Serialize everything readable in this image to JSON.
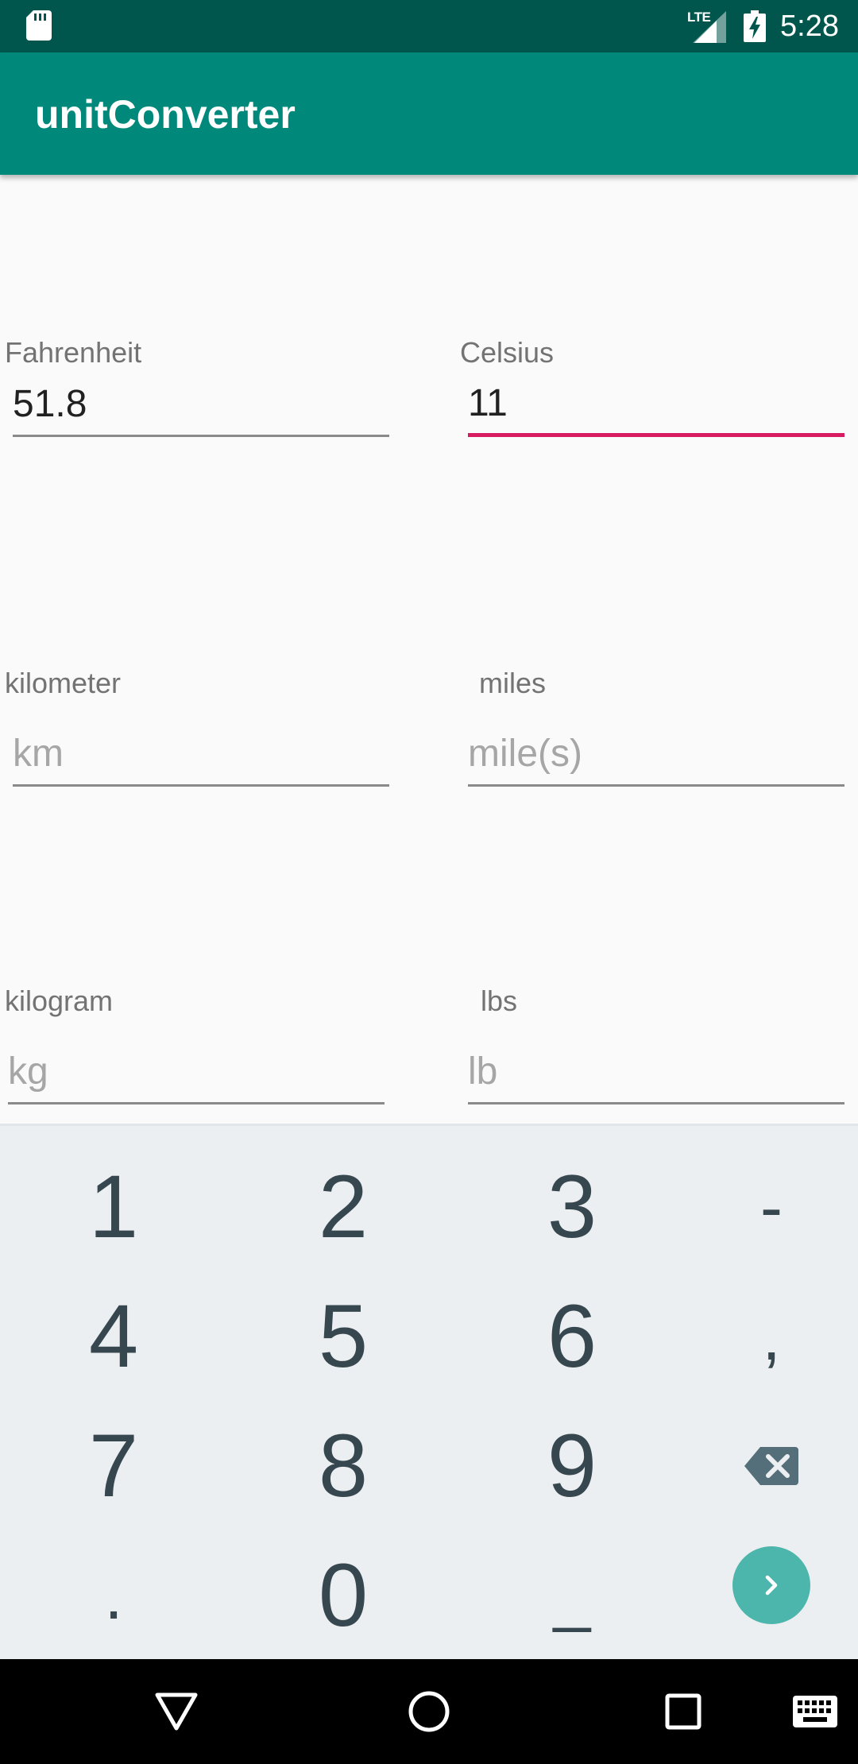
{
  "status_bar": {
    "time": "5:28",
    "network_label": "LTE",
    "icons": [
      "sd-card-icon",
      "signal-icon",
      "battery-charging-icon"
    ]
  },
  "app": {
    "title": "unitConverter"
  },
  "fields": {
    "fahrenheit": {
      "label": "Fahrenheit",
      "value": "51.8",
      "placeholder": ""
    },
    "celsius": {
      "label": "Celsius",
      "value": "11",
      "placeholder": ""
    },
    "kilometer": {
      "label": "kilometer",
      "value": "",
      "placeholder": "km"
    },
    "miles": {
      "label": "miles",
      "value": "",
      "placeholder": "mile(s)"
    },
    "kilogram": {
      "label": "kilogram",
      "value": "",
      "placeholder": "kg"
    },
    "lbs": {
      "label": "lbs",
      "value": "",
      "placeholder": "lb"
    }
  },
  "keypad": {
    "keys": {
      "k1": "1",
      "k2": "2",
      "k3": "3",
      "minus": "-",
      "k4": "4",
      "k5": "5",
      "k6": "6",
      "comma": ",",
      "k7": "7",
      "k8": "8",
      "k9": "9",
      "period": ".",
      "k0": "0",
      "space": "_"
    },
    "icons": [
      "backspace-icon",
      "go-arrow-icon"
    ]
  },
  "nav_bar": {
    "icons": [
      "back-icon",
      "home-icon",
      "recents-icon",
      "keyboard-switch-icon"
    ]
  },
  "colors": {
    "status_bar": "#00564d",
    "app_bar": "#00897b",
    "focus_accent": "#d81b60",
    "keypad_background": "#eceff1",
    "key_text": "#37474f",
    "go_key": "#4db6ac"
  }
}
